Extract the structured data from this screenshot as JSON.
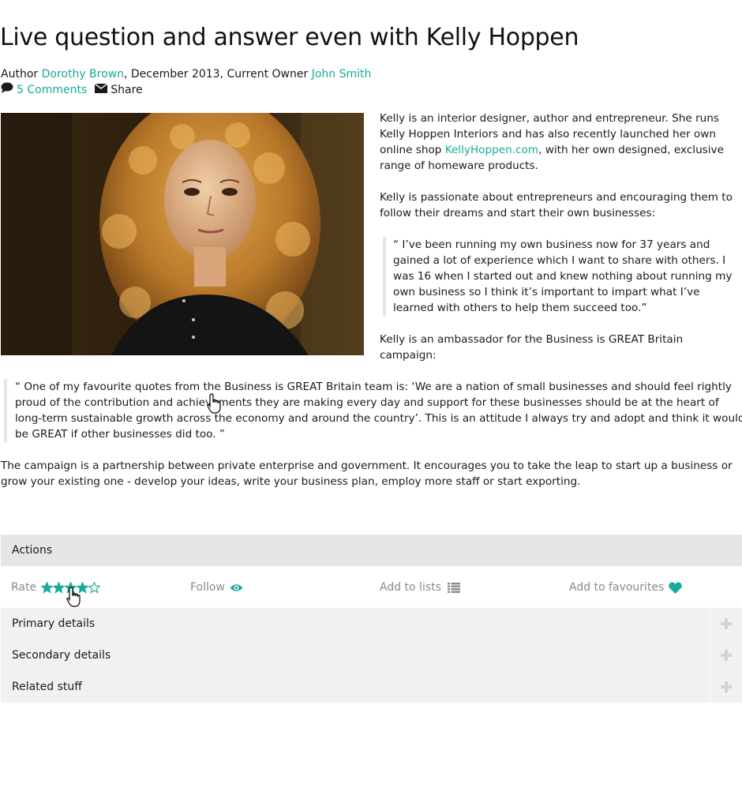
{
  "article": {
    "title": "Live question and answer even with Kelly Hoppen",
    "meta": {
      "author_label": "Author",
      "author": "Dorothy Brown",
      "date_text": ", December 2013, Current Owner",
      "owner": "John Smith",
      "comments": "5 Comments",
      "share": "Share"
    },
    "intro": {
      "p1_before": "Kelly is an interior designer, author and entrepreneur. She runs Kelly Hoppen Interiors and has also recently launched her own online shop ",
      "p1_link": "KellyHoppen.com",
      "p1_after": ", with her own designed, exclusive range of homeware products.",
      "p2": "Kelly is passionate about entrepreneurs and encouraging them to follow their dreams and start their own businesses:",
      "quote": "“ I’ve been running my own business now for 37 years and gained a lot of experience which I want to share with others. I was 16 when I started out and knew nothing about running my own business so I think it’s important to impart what I’ve learned with others to help them succeed too.”",
      "p3": "Kelly is an ambassador for the Business is GREAT Britain campaign:"
    },
    "quote2": "“ One of my favourite quotes from the Business is GREAT Britain team is: ‘We are a nation of small businesses and should feel rightly proud of the contribution and achievements they are making every day and support for these businesses should be at the heart of long-term sustainable growth across the economy and around the country’. This is an attitude I always try and adopt and think it would be GREAT if other businesses did too. ”",
    "body3": "The campaign is a partnership between private enterprise and government. It encourages you to take the leap to start up a business or grow your existing one - develop your ideas, write your business plan, employ more staff or start exporting."
  },
  "actions": {
    "heading": "Actions",
    "rate_label": "Rate",
    "rating": 4,
    "rating_max": 5,
    "follow_label": "Follow",
    "lists_label": "Add to lists",
    "favourites_label": "Add to favourites"
  },
  "accordion": [
    {
      "label": "Primary details"
    },
    {
      "label": "Secondary details"
    },
    {
      "label": "Related stuff"
    }
  ],
  "colors": {
    "accent": "#1aa99a",
    "muted": "#8a8a8a",
    "panel": "#f1f1f1",
    "panel_dark": "#e6e6e6"
  },
  "icons": [
    "comment-icon",
    "envelope-icon",
    "star-icon",
    "eye-icon",
    "list-icon",
    "heart-icon",
    "plus-icon",
    "hand-cursor-icon"
  ]
}
